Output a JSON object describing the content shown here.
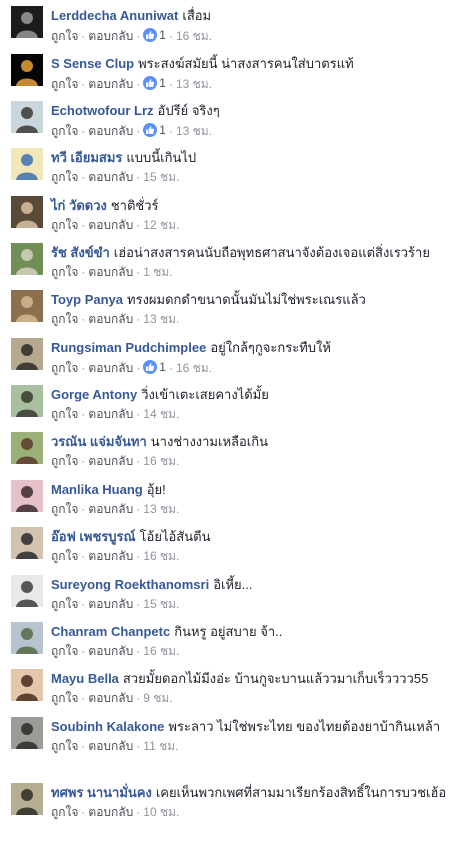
{
  "actions": {
    "like": "ถูกใจ",
    "reply": "ตอบกลับ",
    "separator": "·"
  },
  "comments": [
    {
      "author": "Lerddecha Anuniwat",
      "text": "เสื่อม",
      "likes": "1",
      "time": "16 ชม.",
      "avatar": "avatar-mask",
      "colors": [
        "#1c1c1c",
        "#9a9a9a"
      ]
    },
    {
      "author": "S Sense Clup",
      "text": "พระสงฆ์สมัยนี้ น่าสงสารคนใส่บาตรแท้",
      "likes": "1",
      "time": "13 ชม.",
      "avatar": "avatar-candle",
      "colors": [
        "#050505",
        "#e8a23a"
      ]
    },
    {
      "author": "Echotwofour Lrz",
      "text": "อัปรีย์ จริงๆ",
      "likes": "1",
      "time": "13 ชม.",
      "avatar": "avatar-person-outdoor",
      "colors": [
        "#c9d6dc",
        "#3b3a36"
      ]
    },
    {
      "author": "ทวี เอียมสมร",
      "text": "แบบนี้เกินไป",
      "likes": "",
      "time": "15 ชม.",
      "avatar": "avatar-cartoon",
      "colors": [
        "#f2e7b8",
        "#3b6fb0"
      ]
    },
    {
      "author": "ไก่ วัดดวง",
      "text": "ชาติชั่วร์",
      "likes": "",
      "time": "12 ชม.",
      "avatar": "avatar-people-dark",
      "colors": [
        "#5a4a3a",
        "#d9c2a0"
      ]
    },
    {
      "author": "รัช สังข์ขำ",
      "text": "เฮ่อน่าสงสารคนนับถือพุทธศาสนาจังต้องเจอแต่สิ่งเรวร้าย",
      "likes": "",
      "time": "1 ชม.",
      "avatar": "avatar-scenery",
      "colors": [
        "#6f8f56",
        "#d8d2c0"
      ]
    },
    {
      "author": "Toyp Panya",
      "text": "ทรงผมดกดำขนาดนั้นมันไม่ใช่พระเณรแล้ว",
      "likes": "",
      "time": "13 ชม.",
      "avatar": "avatar-sepia",
      "colors": [
        "#8b6f4e",
        "#d3b892"
      ]
    },
    {
      "author": "Rungsiman Pudchimplee",
      "text": "อยู่ใกล้ๆกูจะกระทืบให้",
      "likes": "1",
      "time": "16 ชม.",
      "avatar": "avatar-group",
      "colors": [
        "#b7a98f",
        "#2e2a28"
      ]
    },
    {
      "author": "Gorge Antony",
      "text": "วิ่งเข้าเตะเสยคางได้มั้ย",
      "likes": "",
      "time": "14 ชม.",
      "avatar": "avatar-man-green",
      "colors": [
        "#a8bfa0",
        "#3a3a30"
      ]
    },
    {
      "author": "วรณัน แจ่มจันทา",
      "text": "นางช่างงามเหลือเกิน",
      "likes": "",
      "time": "16 ชม.",
      "avatar": "avatar-woman-field",
      "colors": [
        "#9cb07a",
        "#5a3b2b"
      ]
    },
    {
      "author": "Manlika Huang",
      "text": "อุ้ย!",
      "likes": "",
      "time": "13 ชม.",
      "avatar": "avatar-woman-pink",
      "colors": [
        "#e6c1c9",
        "#3a2a2a"
      ]
    },
    {
      "author": "อ๊อฟ เพชรบูรณ์",
      "text": "โอ้ยไอ้สันตีน",
      "likes": "",
      "time": "16 ชม.",
      "avatar": "avatar-selfie",
      "colors": [
        "#d2c3b0",
        "#2a2a2a"
      ]
    },
    {
      "author": "Sureyong Roekthanomsri",
      "text": "อิเหี้ย...",
      "likes": "",
      "time": "15 ชม.",
      "avatar": "avatar-man-white",
      "colors": [
        "#e9e9ea",
        "#3d3d40"
      ]
    },
    {
      "author": "Chanram Chanpetc",
      "text": "กินหรู อยู่สบาย จ้า..",
      "likes": "",
      "time": "16 ชม.",
      "avatar": "avatar-landscape",
      "colors": [
        "#b7c4cf",
        "#586848"
      ]
    },
    {
      "author": "Mayu Bella",
      "text": "สวยมั้ยดอกไม้มีงอ่ะ บ้านกูจะบานแล้ววมาเก็บเร็วววว55",
      "likes": "",
      "time": "9 ชม.",
      "avatar": "avatar-woman-smile",
      "colors": [
        "#e3c7a8",
        "#4a2c1e"
      ]
    },
    {
      "author": "Soubinh Kalakone",
      "text": "พระลาว ไม่ใช่พระไทย ของไทยต้องยาบ้ากินเหล้า",
      "likes": "",
      "time": "11 ชม.",
      "avatar": "avatar-man-grey",
      "colors": [
        "#9b9b98",
        "#2d2b28"
      ]
    },
    {
      "author": "ทศพร นานามั่นคง",
      "text": "เคยเห็นพวกเพศที่สามมาเรียกร้องสิทธิ์ในการบวชเฮ้อ",
      "likes": "",
      "time": "10 ชม.",
      "avatar": "avatar-man-outdoor",
      "colors": [
        "#b5ae92",
        "#2f2a22"
      ]
    }
  ]
}
